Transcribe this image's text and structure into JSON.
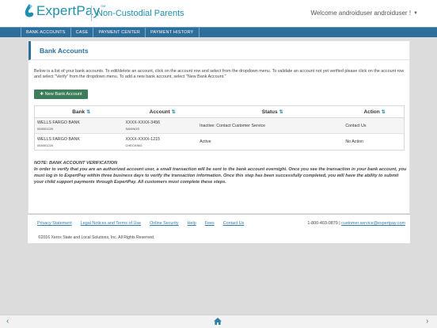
{
  "header": {
    "logo_text": "ExpertPay",
    "logo_tm": "SM",
    "portal_title": "Non-Custodial Parents",
    "welcome": "Welcome androiduser androiduser !"
  },
  "nav": {
    "items": [
      {
        "label": "BANK ACCOUNTS"
      },
      {
        "label": "CASE"
      },
      {
        "label": "PAYMENT CENTER"
      },
      {
        "label": "PAYMENT HISTORY"
      }
    ]
  },
  "panel": {
    "title": "Bank Accounts",
    "intro": "Below is a list of your bank accounts. To edit/delete an account, click on the account row and select from the dropdown menu. To validate an account not yet verified please click on the account row and select \"Verify\" from the dropdown menu. To add a new bank account, select \"New Bank Account.\"",
    "new_button": "New Bank Account"
  },
  "table": {
    "columns": [
      {
        "label": "Bank"
      },
      {
        "label": "Account"
      },
      {
        "label": "Status"
      },
      {
        "label": "Action"
      }
    ],
    "rows": [
      {
        "bank": "WELLS FARGO BANK",
        "routing": "054001220",
        "account": "XXXX-XXXX-3456",
        "type": "SAVINGS",
        "status": "Inactive: Contact Customer Service",
        "action": "Contact Us"
      },
      {
        "bank": "WELLS FARGO BANK",
        "routing": "054001220",
        "account": "XXXX-XXXX-1215",
        "type": "CHECKING",
        "status": "Active",
        "action": "No Action"
      }
    ]
  },
  "note": {
    "title": "NOTE: BANK ACCOUNT VERIFICATION",
    "body": "In order to verify that you are an authorized account user, a small transaction will be sent to the bank account overnight. Once you see the transaction in your bank account, you must log in to ExpertPay within three business days to verify the transaction information. Once this step has been successfully completed, you will have the ability to submit your child support payments through ExpertPay. All customers must complete these steps."
  },
  "footer": {
    "links": [
      {
        "label": "Privacy Statement"
      },
      {
        "label": "Legal Notices and Terms of Use"
      },
      {
        "label": "Online Security"
      },
      {
        "label": "Help"
      },
      {
        "label": "Fees"
      },
      {
        "label": "Contact Us"
      }
    ],
    "phone": "1-800-403-0879",
    "email": "customer.service@expertpay.com",
    "copyright": "©2016 Xerox State and Local Solutions, Inc. All Rights Reserved."
  },
  "icons": {
    "plus": "plus-icon",
    "sort": "sort-icon",
    "back": "back-arrow-icon",
    "home": "home-icon",
    "forward": "forward-arrow-icon"
  },
  "colors": {
    "brand": "#1e8fae",
    "nav": "#2d6e9a",
    "button": "#3d7e5a"
  }
}
